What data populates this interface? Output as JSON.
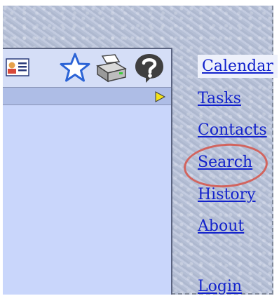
{
  "nav": {
    "items": [
      {
        "label": "Calendar",
        "current": true
      },
      {
        "label": "Tasks"
      },
      {
        "label": "Contacts"
      },
      {
        "label": "Search"
      },
      {
        "label": "History"
      },
      {
        "label": "About"
      },
      {
        "label": "Login"
      }
    ]
  },
  "toolbar": {
    "icons": [
      "address-card-icon",
      "star-icon",
      "printer-icon",
      "help-icon"
    ]
  },
  "subbar": {
    "icons": [
      "play-arrow-icon"
    ]
  },
  "annotation": {
    "highlighted_item": "Search",
    "color": "#d2645e"
  }
}
